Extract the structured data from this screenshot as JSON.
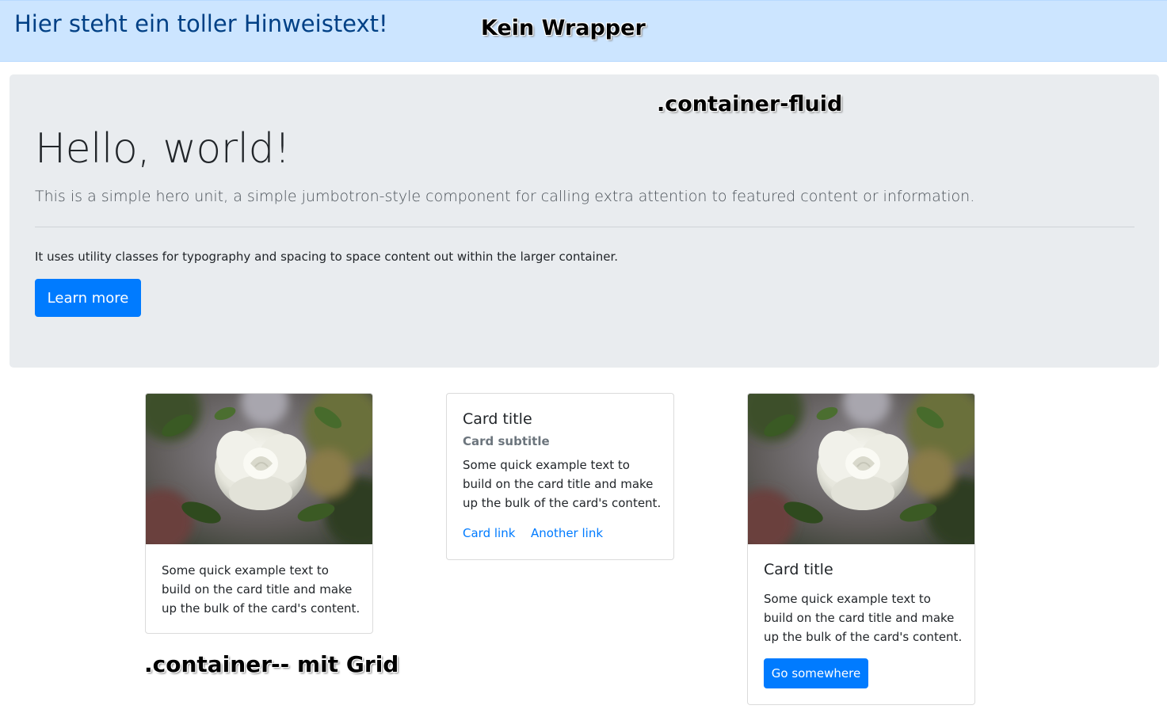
{
  "alert": {
    "text": "Hier steht ein toller Hinweistext!",
    "color": "#004085",
    "background": "#cce5ff"
  },
  "annotations": {
    "no_wrapper": "Kein Wrapper",
    "container_fluid": ".container-fluid",
    "container": ".container",
    "with_grid": "-- mit Grid"
  },
  "jumbotron": {
    "title": "Hello, world!",
    "lead": "This is a simple hero unit, a simple jumbotron-style component for calling extra attention to featured content or information.",
    "body": "It uses utility classes for typography and spacing to space content out within the larger container.",
    "button_label": "Learn more",
    "background": "#e9ecef"
  },
  "cards": {
    "card1": {
      "image_icon": "white-rose-photo",
      "text": "Some quick example text to build on the card title and make up the bulk of the card's content."
    },
    "card2": {
      "title": "Card title",
      "subtitle": "Card subtitle",
      "text": "Some quick example text to build on the card title and make up the bulk of the card's content.",
      "link1": "Card link",
      "link2": "Another link"
    },
    "card3": {
      "image_icon": "white-rose-photo",
      "title": "Card title",
      "text": "Some quick example text to build on the card title and make up the bulk of the card's content.",
      "button_label": "Go somewhere"
    }
  },
  "colors": {
    "primary": "#007bff",
    "muted": "#6c757d",
    "text": "#212529"
  }
}
